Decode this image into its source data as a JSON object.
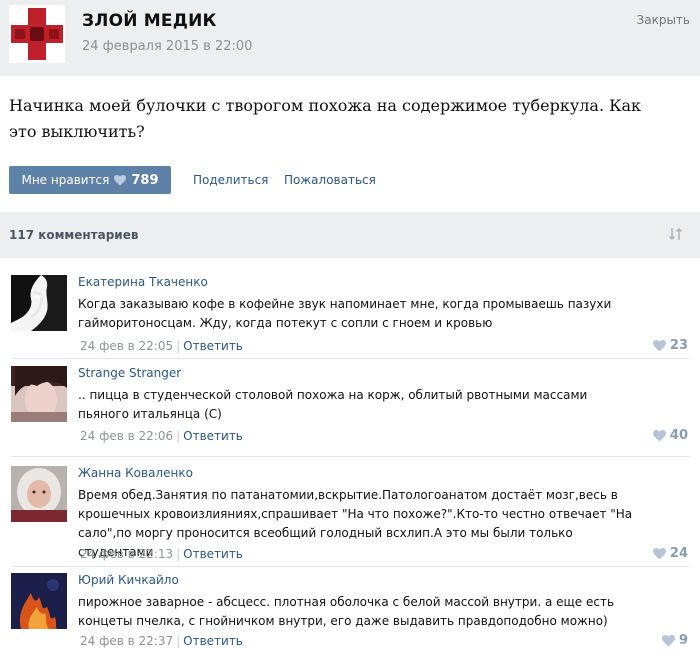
{
  "post": {
    "group_name": "ЗЛОЙ МЕДИК",
    "date": "24 февраля 2015 в 22:00",
    "close_label": "Закрыть",
    "text": "Начинка моей булочки с творогом похожа на содержимое туберкула. Как это выключить?",
    "like_label": "Мне нравится",
    "like_count": "789",
    "share_label": "Поделиться",
    "report_label": "Пожаловаться"
  },
  "comments_header": {
    "count_label": "117 комментариев"
  },
  "comments": [
    {
      "author": "Екатерина Ткаченко",
      "text": "Когда заказываю кофе в кофейне звук напоминает мне, когда промываешь пазухи гайморитоносцам. Жду, когда потекут с сопли с гноем и кровью",
      "time": "24 фев в 22:05",
      "reply_label": "Ответить",
      "likes": "23"
    },
    {
      "author": "Strange Stranger",
      "text": ".. пицца в студенческой столовой похожа на корж, облитый рвотными массами пьяного итальянца (С)",
      "time": "24 фев в 22:06",
      "reply_label": "Ответить",
      "likes": "40"
    },
    {
      "author": "Жанна Коваленко",
      "text": "Время обед.Занятия по патанатомии,вскрытие.Патологоанатом достаёт мозг,весь в крошечных кровоизлияниях,спрашивает \"На что похоже?\".Кто-то честно отвечает \"На сало\",по моргу проносится всеобщий голодный всхлип.А это мы были только студентами",
      "time": "24 фев в 22:13",
      "reply_label": "Ответить",
      "likes": "24"
    },
    {
      "author": "Юрий Кичкайло",
      "text": "пирожное заварное - абсцесс. плотная оболочка с белой массой внутри. а еще есть концеты пчелка, с гнойничком внутри, его даже выдавить правдоподобно можно)",
      "time": "24 фев в 22:37",
      "reply_label": "Ответить",
      "likes": "9"
    }
  ],
  "icons": {
    "heart": "heart-icon",
    "sort": "sort-arrows-icon"
  },
  "colors": {
    "accent": "#5e81a8",
    "link": "#2a5885",
    "header_bg": "#edeef0",
    "like_heart": "#b6c4d6"
  }
}
